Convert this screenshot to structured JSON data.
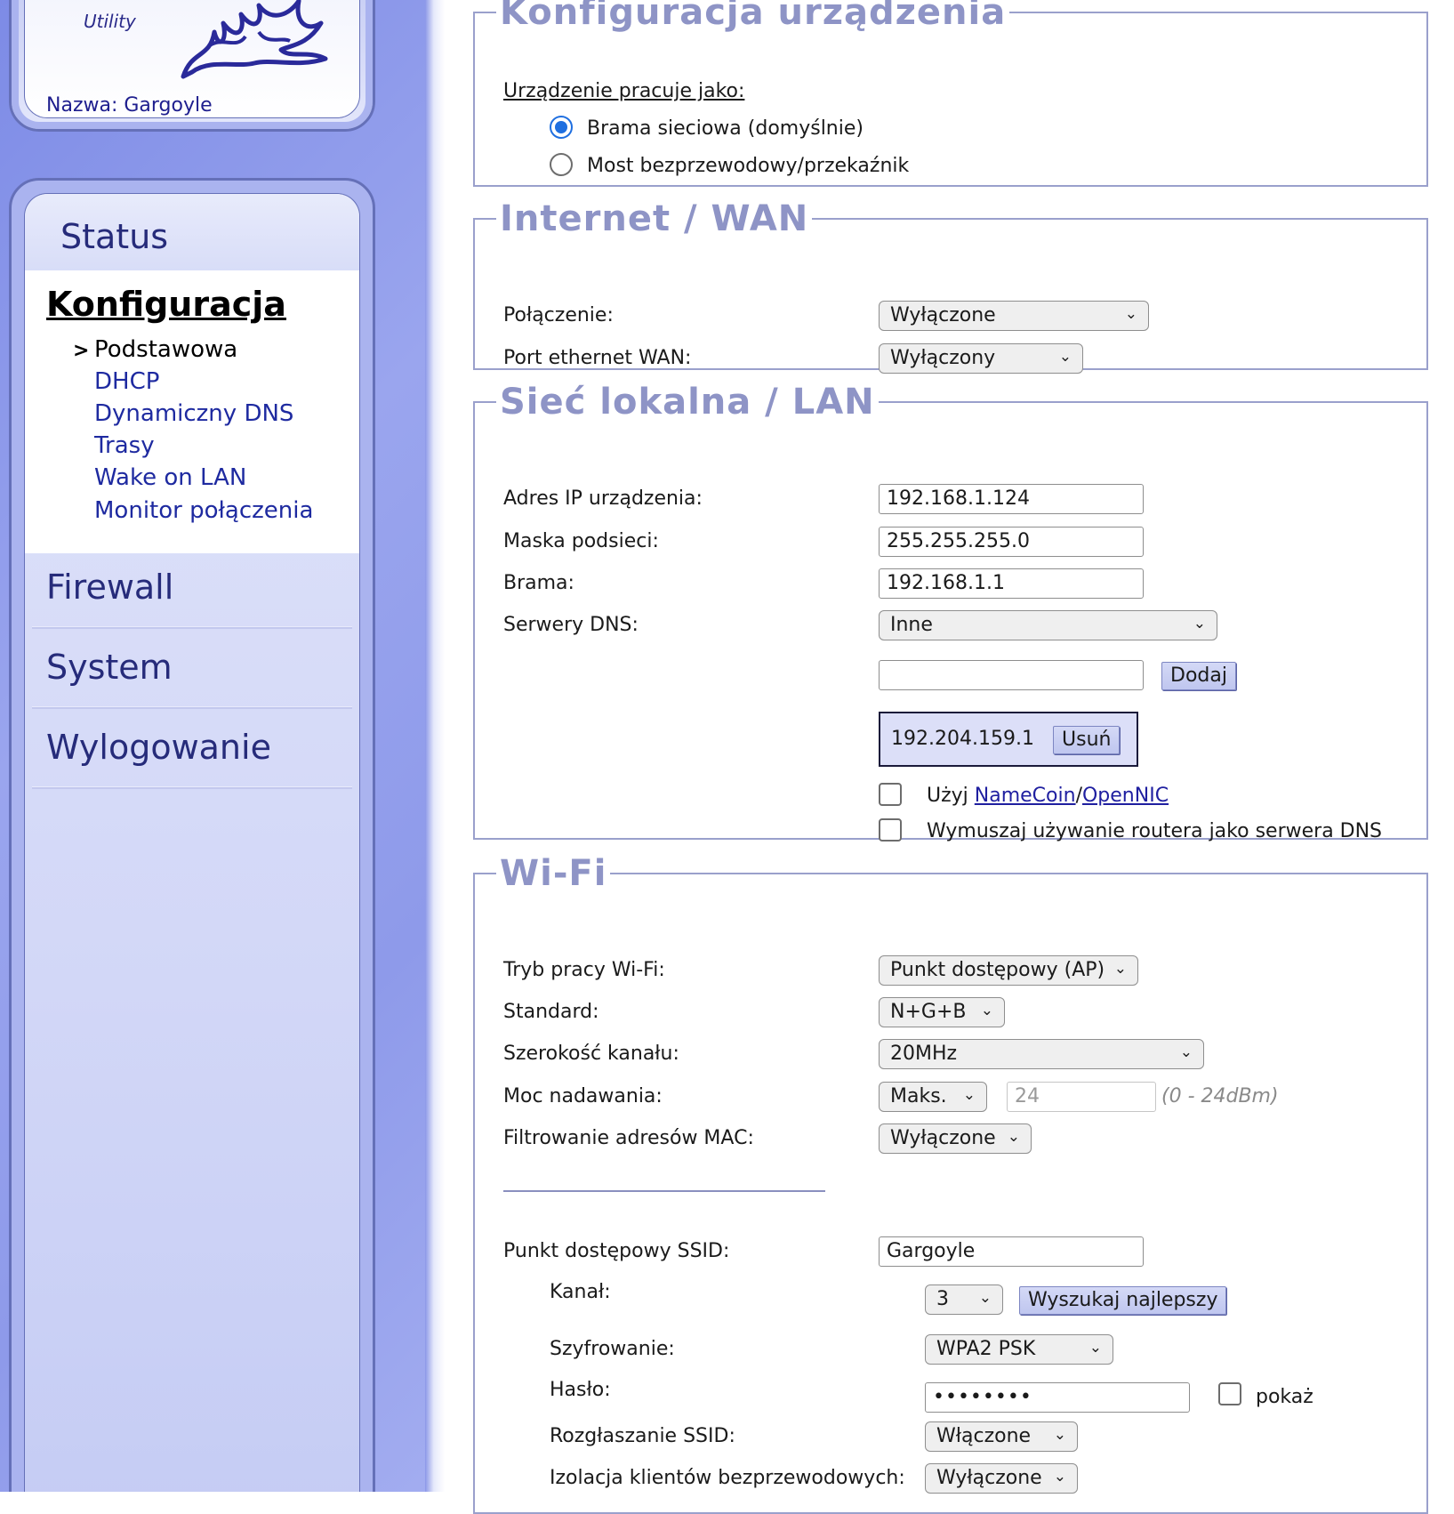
{
  "sidebar": {
    "logo_subtitle": "Utility",
    "device_name": "Nazwa: Gargoyle",
    "status": "Status",
    "section_title": "Konfiguracja",
    "arrow": ">",
    "submenu": [
      {
        "label": "Podstawowa"
      },
      {
        "label": "DHCP"
      },
      {
        "label": "Dynamiczny DNS"
      },
      {
        "label": "Trasy"
      },
      {
        "label": "Wake on LAN"
      },
      {
        "label": "Monitor połączenia"
      }
    ],
    "items": [
      {
        "label": "Firewall"
      },
      {
        "label": "System"
      },
      {
        "label": "Wylogowanie"
      }
    ]
  },
  "device_config": {
    "title": "Konfiguracja urządzenia",
    "mode_label": "Urządzenie pracuje jako:",
    "options": [
      {
        "label": "Brama sieciowa (domyślnie)",
        "selected": true
      },
      {
        "label": "Most bezprzewodowy/przekaźnik",
        "selected": false
      }
    ]
  },
  "wan": {
    "title": "Internet / WAN",
    "connection_label": "Połączenie:",
    "connection_value": "Wyłączone",
    "port_label": "Port ethernet WAN:",
    "port_value": "Wyłączony"
  },
  "lan": {
    "title": "Sieć lokalna / LAN",
    "ip_label": "Adres IP urządzenia:",
    "ip_value": "192.168.1.124",
    "mask_label": "Maska podsieci:",
    "mask_value": "255.255.255.0",
    "gateway_label": "Brama:",
    "gateway_value": "192.168.1.1",
    "dns_label": "Serwery DNS:",
    "dns_value": "Inne",
    "dns_new_value": "",
    "add_button": "Dodaj",
    "dns_entry": "192.204.159.1",
    "remove_button": "Usuń",
    "namecoin_prefix": "Użyj ",
    "namecoin_link": "NameCoin",
    "slash": "/",
    "opennic_link": "OpenNIC",
    "force_dns_label": "Wymuszaj używanie routera jako serwera DNS"
  },
  "wifi": {
    "title": "Wi-Fi",
    "mode_label": "Tryb pracy Wi-Fi:",
    "mode_value": "Punkt dostępowy (AP)",
    "standard_label": "Standard:",
    "standard_value": "N+G+B",
    "width_label": "Szerokość kanału:",
    "width_value": "20MHz",
    "power_label": "Moc nadawania:",
    "power_value": "Maks.",
    "power_input": "24",
    "power_hint": "(0 - 24dBm)",
    "mac_label": "Filtrowanie adresów MAC:",
    "mac_value": "Wyłączone",
    "ssid_label": "Punkt dostępowy SSID:",
    "ssid_value": "Gargoyle",
    "channel_label": "Kanał:",
    "channel_value": "3",
    "find_best_button": "Wyszukaj najlepszy",
    "encryption_label": "Szyfrowanie:",
    "encryption_value": "WPA2 PSK",
    "password_label": "Hasło:",
    "password_value": "••••••••",
    "show_label": "pokaż",
    "broadcast_label": "Rozgłaszanie SSID:",
    "broadcast_value": "Włączone",
    "isolation_label": "Izolacja klientów bezprzewodowych:",
    "isolation_value": "Wyłączone"
  },
  "icons": {
    "select_chevron": "chevron-down-icon",
    "logo": "gargoyle-logo"
  }
}
